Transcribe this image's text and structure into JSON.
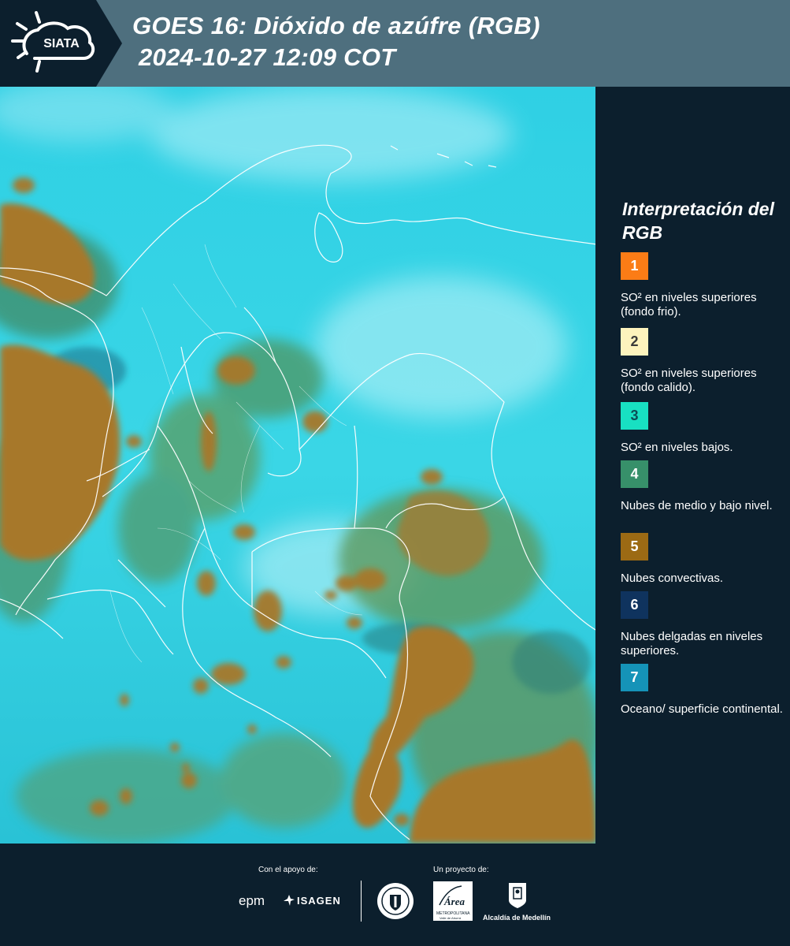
{
  "header": {
    "logo_text": "SIATA",
    "title_line1": "GOES 16: Dióxido de azúfre (RGB)",
    "title_line2": "2024-10-27 12:09 COT"
  },
  "colors": {
    "header_bg": "#4e6f7e",
    "panel_bg": "#0c1f2d",
    "map_base": "#35d5e6",
    "convective": "#a7782c",
    "mid_low_cloud": "#3a8a64"
  },
  "legend": {
    "title": "Interpretación del RGB",
    "items": [
      {
        "number": "1",
        "color": "#fb7c16",
        "label": "SO² en niveles superiores (fondo frio)."
      },
      {
        "number": "2",
        "color": "#fdf3bd",
        "label": "SO² en niveles superiores (fondo calido)."
      },
      {
        "number": "3",
        "color": "#18e0c2",
        "label": "SO² en niveles bajos."
      },
      {
        "number": "4",
        "color": "#37906a",
        "label": "Nubes de medio y bajo nivel."
      },
      {
        "number": "5",
        "color": "#9c6a14",
        "label": "Nubes convectivas."
      },
      {
        "number": "6",
        "color": "#0f335e",
        "label": "Nubes delgadas en niveles superiores."
      },
      {
        "number": "7",
        "color": "#1593b8",
        "label": "Oceano/ superficie continental."
      }
    ]
  },
  "footer": {
    "support_caption": "Con el apoyo de:",
    "project_caption": "Un proyecto de:",
    "sponsor_epm": "epm",
    "sponsor_isagen": "ISAGEN",
    "area_logo_line1": "Área",
    "area_logo_line2": "METROPOLITANA",
    "area_logo_line3": "Valle de Aburrá",
    "alcaldia": "Alcaldía de Medellín"
  }
}
